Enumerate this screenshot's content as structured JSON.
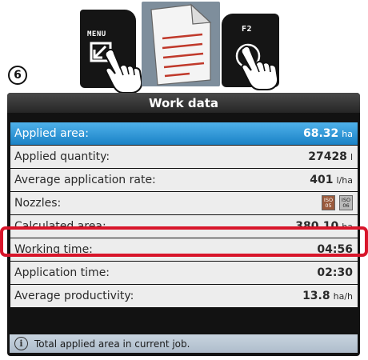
{
  "step": {
    "number": "6"
  },
  "keys": {
    "menu_label": "MENU",
    "f2_label": "F2"
  },
  "icons": {
    "doc": "document-icon",
    "hand": "pointing-hand-icon",
    "info": "info-icon"
  },
  "panel": {
    "title": "Work data",
    "rows": [
      {
        "label": "Applied area:",
        "value": "68.32",
        "unit": "ha",
        "selected": true
      },
      {
        "label": "Applied quantity:",
        "value": "27428",
        "unit": "l"
      },
      {
        "label": "Average application rate:",
        "value": "401",
        "unit": "l/ha"
      },
      {
        "label": "Nozzles:",
        "nozzles": [
          {
            "top": "ISO",
            "bottom": "05"
          },
          {
            "top": "ISO",
            "bottom": "06"
          }
        ]
      },
      {
        "label": "Calculated area:",
        "value": "380.10",
        "unit": "ha",
        "highlighted": true
      },
      {
        "label": "Working time:",
        "value": "04:56",
        "unit": ""
      },
      {
        "label": "Application time:",
        "value": "02:30",
        "unit": ""
      },
      {
        "label": "Average productivity:",
        "value": "13.8",
        "unit": "ha/h"
      }
    ],
    "info": "Total applied area in current job."
  },
  "colors": {
    "selected": "#2a95d8",
    "highlight": "#d8152a",
    "info_bar": "#b8c6d4"
  }
}
